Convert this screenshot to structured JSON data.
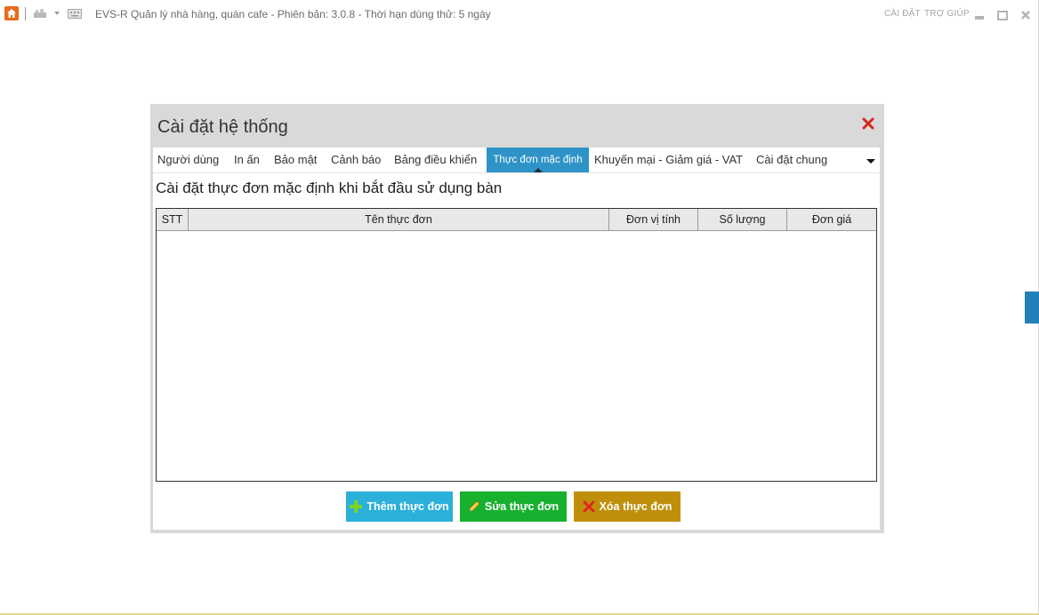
{
  "window": {
    "title": "EVS-R Quản lý nhà hàng, quán cafe - Phiên bản: 3.0.8 - Thời hạn dùng thử: 5 ngày",
    "settings_link": "CÀI ĐẶT",
    "help_link": "TRỢ GIÚP"
  },
  "dialog": {
    "title": "Cài đặt hệ thống",
    "tabs": [
      {
        "label": "Người dùng"
      },
      {
        "label": "In ấn"
      },
      {
        "label": "Bảo mật"
      },
      {
        "label": "Cảnh báo"
      },
      {
        "label": "Bảng điều khiển"
      },
      {
        "label": "Thực đơn mặc định",
        "active": true
      },
      {
        "label": "Khuyến mại - Giảm giá - VAT"
      },
      {
        "label": "Cài đặt chung"
      }
    ],
    "section_title": "Cài đặt thực đơn mặc định khi bắt đầu sử dụng bàn",
    "table": {
      "columns": [
        "STT",
        "Tên thực đơn",
        "Đơn vị tính",
        "Số lượng",
        "Đơn giá"
      ],
      "rows": []
    },
    "buttons": {
      "add": "Thêm thực đơn",
      "edit": "Sửa thực đơn",
      "delete": "Xóa thực đơn"
    }
  },
  "colors": {
    "active_tab": "#2e93c7",
    "add_button": "#2bb0d9",
    "edit_button": "#17b02f",
    "delete_button": "#bf8f0b",
    "close_icon": "#d9261c",
    "side_tab": "#2380b8"
  },
  "icons": [
    "home-icon",
    "restaurant-icon",
    "dropdown-caret-icon",
    "keyboard-icon",
    "minimize-icon",
    "maximize-icon",
    "close-icon",
    "chevron-down-icon",
    "plus-icon",
    "pencil-icon",
    "x-icon"
  ]
}
